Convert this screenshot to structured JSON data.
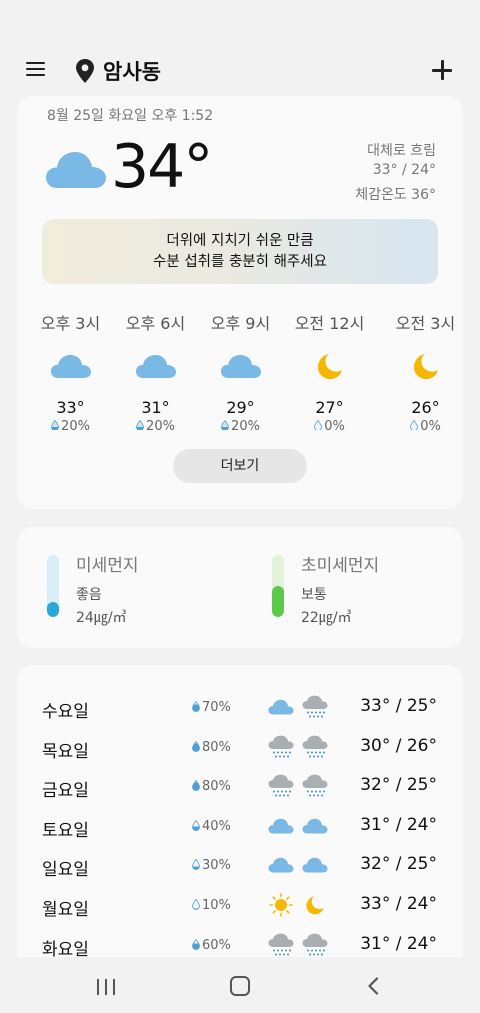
{
  "header": {
    "location": "암사동"
  },
  "current": {
    "datetime": "8월 25일 화요일 오후 1:52",
    "temp": "34°",
    "condition": "대체로 흐림",
    "hi_lo": "33° / 24°",
    "feels_like": "체감온도 36°",
    "advisory_line1": "더위에 지치기 쉬운 만큼",
    "advisory_line2": "수분 섭취를 충분히 해주세요"
  },
  "hourly": [
    {
      "time": "오후 3시",
      "icon": "cloud-icon",
      "temp": "33°",
      "rain": "20%"
    },
    {
      "time": "오후 6시",
      "icon": "cloud-icon",
      "temp": "31°",
      "rain": "20%"
    },
    {
      "time": "오후 9시",
      "icon": "cloud-icon",
      "temp": "29°",
      "rain": "20%"
    },
    {
      "time": "오전 12시",
      "icon": "moon-icon",
      "temp": "27°",
      "rain": "0%"
    },
    {
      "time": "오전 3시",
      "icon": "moon-icon",
      "temp": "26°",
      "rain": "0%"
    }
  ],
  "more_label": "더보기",
  "air": {
    "pm10": {
      "title": "미세먼지",
      "level": "좋음",
      "value": "24㎍/㎥",
      "fill_fraction": 0.25,
      "color": "#29a8d8"
    },
    "pm25": {
      "title": "초미세먼지",
      "level": "보통",
      "value": "22㎍/㎥",
      "fill_fraction": 0.5,
      "color": "#5cc94a"
    }
  },
  "daily": [
    {
      "day": "수요일",
      "rain": "70%",
      "icon_day": "cloud-icon",
      "icon_night": "rain-cloud-icon",
      "temps": "33° / 25°"
    },
    {
      "day": "목요일",
      "rain": "80%",
      "icon_day": "gray-rain-cloud-icon",
      "icon_night": "gray-rain-cloud-icon",
      "temps": "30° / 26°"
    },
    {
      "day": "금요일",
      "rain": "80%",
      "icon_day": "gray-rain-cloud-icon",
      "icon_night": "gray-rain-cloud-icon",
      "temps": "32° / 25°"
    },
    {
      "day": "토요일",
      "rain": "40%",
      "icon_day": "cloud-icon",
      "icon_night": "cloud-icon",
      "temps": "31° / 24°"
    },
    {
      "day": "일요일",
      "rain": "30%",
      "icon_day": "cloud-icon",
      "icon_night": "cloud-icon",
      "temps": "32° / 25°"
    },
    {
      "day": "월요일",
      "rain": "10%",
      "icon_day": "sun-icon",
      "icon_night": "moon-icon",
      "temps": "33° / 24°"
    },
    {
      "day": "화요일",
      "rain": "60%",
      "icon_day": "gray-rain-cloud-icon",
      "icon_night": "gray-rain-cloud-icon",
      "temps": "31° / 24°"
    }
  ]
}
